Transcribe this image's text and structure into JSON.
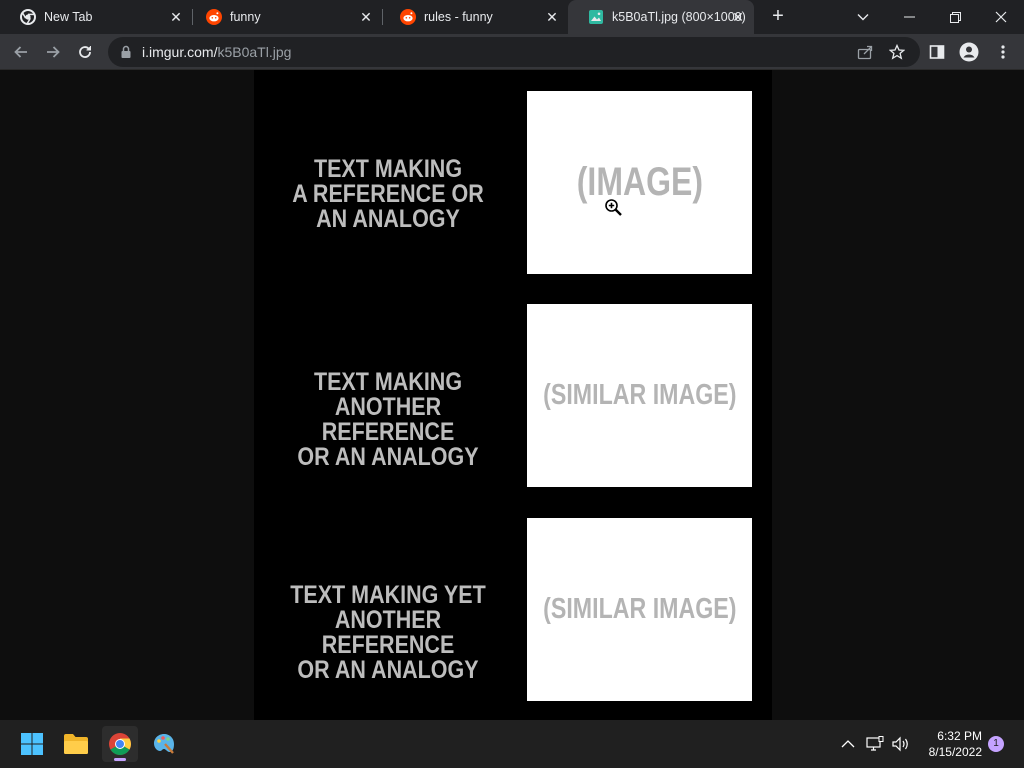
{
  "browser": {
    "tabs": [
      {
        "title": "New Tab",
        "icon": "chrome-icon"
      },
      {
        "title": "funny",
        "icon": "reddit-icon"
      },
      {
        "title": "rules - funny",
        "icon": "reddit-icon"
      },
      {
        "title": "k5B0aTl.jpg (800×1000)",
        "icon": "image-file-icon"
      }
    ],
    "url_host": "i.imgur.com/",
    "url_path": "k5B0aTl.jpg"
  },
  "meme": {
    "rows": [
      {
        "text_lines": [
          "TEXT MAKING",
          "A REFERENCE OR",
          "AN ANALOGY"
        ],
        "panel_label": "(IMAGE)"
      },
      {
        "text_lines": [
          "TEXT MAKING",
          "ANOTHER REFERENCE",
          "OR AN ANALOGY"
        ],
        "panel_label": "(SIMILAR IMAGE)"
      },
      {
        "text_lines": [
          "TEXT MAKING YET",
          "ANOTHER REFERENCE",
          "OR AN ANALOGY"
        ],
        "panel_label": "(SIMILAR IMAGE)"
      }
    ]
  },
  "taskbar": {
    "time": "6:32 PM",
    "date": "8/15/2022",
    "notification_count": "1"
  }
}
